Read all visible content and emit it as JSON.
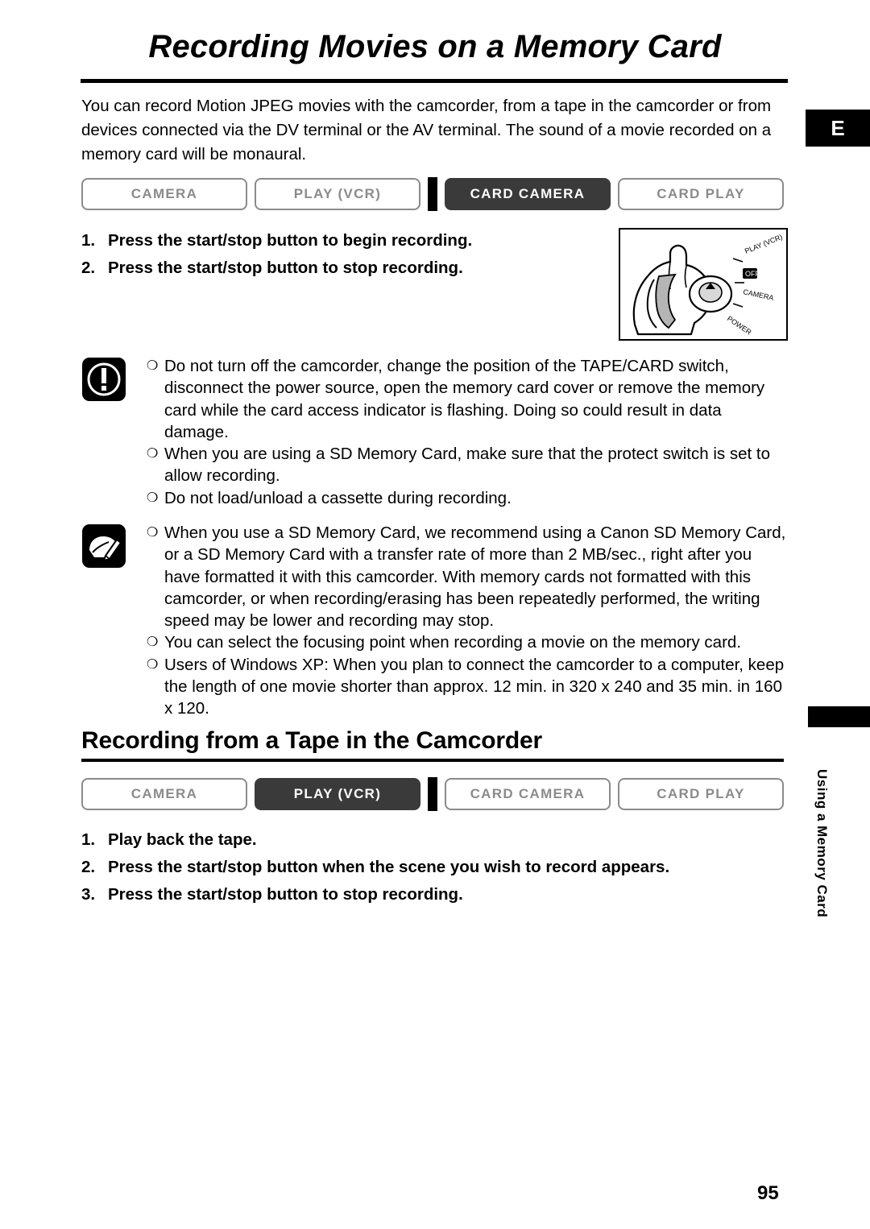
{
  "page": {
    "title": "Recording Movies on a Memory Card",
    "intro": "You can record Motion JPEG movies with the camcorder, from a tape in the camcorder or from devices connected via the DV terminal or the AV terminal. The sound of a movie recorded on a memory card will be monaural.",
    "edition_tab": "E",
    "side_tab_text": "Using a Memory Card",
    "page_number": "95"
  },
  "modebar1": {
    "modes": [
      {
        "label": "CAMERA",
        "active": false
      },
      {
        "label": "PLAY (VCR)",
        "active": false
      },
      {
        "label": "CARD CAMERA",
        "active": true
      },
      {
        "label": "CARD PLAY",
        "active": false
      }
    ]
  },
  "steps1": [
    {
      "num": "1.",
      "text": "Press the start/stop button to begin recording."
    },
    {
      "num": "2.",
      "text": "Press the start/stop button to stop recording."
    }
  ],
  "illustration": {
    "name": "power-dial-hand-illustration",
    "labels": [
      "PLAY (VCR)",
      "OFF",
      "CAMERA",
      "POWER"
    ]
  },
  "caution_notes": {
    "icon": "caution-icon",
    "items": [
      "Do not turn off the camcorder, change the position of the TAPE/CARD switch, disconnect the power source, open the memory card cover or remove the memory card while the card access indicator is flashing. Doing so could result in data damage.",
      "When you are using a SD Memory Card, make sure that the protect switch is set to allow recording.",
      "Do not load/unload a cassette during recording."
    ]
  },
  "info_notes": {
    "icon": "notes-pencil-icon",
    "items": [
      "When you use a SD Memory Card, we recommend using a Canon SD Memory Card, or a SD Memory Card with a transfer rate of more than 2 MB/sec., right after you have formatted it with this camcorder. With memory cards not formatted with this camcorder, or when recording/erasing has been repeatedly performed, the writing speed may be lower and recording may stop.",
      "You can select the focusing point when recording a movie on the memory card.",
      "Users of Windows XP: When you plan to connect the camcorder to a computer, keep the length of one movie shorter than approx. 12 min. in 320 x 240 and 35 min. in 160 x 120."
    ]
  },
  "section2": {
    "heading": "Recording from a Tape in the Camcorder",
    "modes": [
      {
        "label": "CAMERA",
        "active": false
      },
      {
        "label": "PLAY (VCR)",
        "active": true
      },
      {
        "label": "CARD CAMERA",
        "active": false
      },
      {
        "label": "CARD PLAY",
        "active": false
      }
    ],
    "steps": [
      {
        "num": "1.",
        "text": "Play back the tape."
      },
      {
        "num": "2.",
        "text": "Press the start/stop button when the scene you wish to record appears."
      },
      {
        "num": "3.",
        "text": "Press the start/stop button to stop recording."
      }
    ]
  },
  "bullet_glyph": "❍"
}
